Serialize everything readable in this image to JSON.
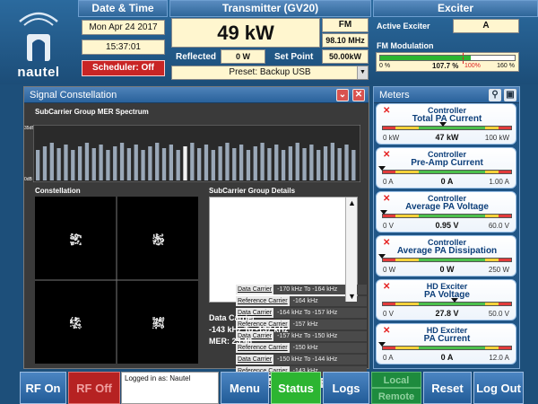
{
  "brand": {
    "logo_text": "nautel"
  },
  "date_time": {
    "header": "Date & Time",
    "date": "Mon Apr 24 2017",
    "time": "15:37:01",
    "scheduler_button": "Scheduler: Off"
  },
  "transmitter": {
    "header": "Transmitter (GV20)",
    "power": "49 kW",
    "mode": "FM",
    "frequency": "98.10 MHz",
    "reflected_label": "Reflected",
    "reflected_value": "0 W",
    "setpoint_label": "Set Point",
    "setpoint_value": "50.00kW",
    "preset": "Preset: Backup USB"
  },
  "exciter": {
    "header": "Exciter",
    "active_label": "Active Exciter",
    "active_value": "A",
    "fm_mod_label": "FM Modulation",
    "fm_mod_low": "0 %",
    "fm_mod_value": "107.7 %",
    "fm_mod_limit": "100%",
    "fm_mod_high": "160 %",
    "fm_mod_level": 0.673
  },
  "signal_panel": {
    "title": "Signal Constellation",
    "mer_title": "SubCarrier Group MER Spectrum",
    "mer_top": "35dB",
    "mer_bottom": "0dB",
    "constellation_title": "Constellation",
    "details_title": "SubCarrier Group Details",
    "details_rows": [
      {
        "type": "Data Carrier",
        "range": "-170 kHz  To  -164 kHz"
      },
      {
        "type": "Reference Carrier",
        "range": "-164 kHz"
      },
      {
        "type": "Data Carrier",
        "range": "-164 kHz  To  -157 kHz"
      },
      {
        "type": "Reference Carrier",
        "range": "-157 kHz"
      },
      {
        "type": "Data Carrier",
        "range": "-157 kHz  To  -150 kHz"
      },
      {
        "type": "Reference Carrier",
        "range": "-150 kHz"
      },
      {
        "type": "Data Carrier",
        "range": "-150 kHz  To  -144 kHz"
      },
      {
        "type": "Reference Carrier",
        "range": "-143 kHz"
      },
      {
        "type": "Data Carrier",
        "range": "-143 kHz  To  -137 kHz"
      }
    ],
    "selected_type": "Data Carrier",
    "selected_range": "-143 kHz To -137 kHz",
    "selected_mer": "MER: 23.48"
  },
  "meters": {
    "title": "Meters",
    "items": [
      {
        "group": "Controller",
        "name": "Total PA Current",
        "low": "0 kW",
        "value": "47 kW",
        "high": "100 kW",
        "level": 0.47
      },
      {
        "group": "Controller",
        "name": "Pre-Amp Current",
        "low": "0 A",
        "value": "0 A",
        "high": "1.00 A",
        "level": 0.0
      },
      {
        "group": "Controller",
        "name": "Average PA Voltage",
        "low": "0 V",
        "value": "0.95 V",
        "high": "60.0 V",
        "level": 0.016
      },
      {
        "group": "Controller",
        "name": "Average PA Dissipation",
        "low": "0 W",
        "value": "0 W",
        "high": "250 W",
        "level": 0.0
      },
      {
        "group": "HD Exciter",
        "name": "PA Voltage",
        "low": "0 V",
        "value": "27.8 V",
        "high": "50.0 V",
        "level": 0.556
      },
      {
        "group": "HD Exciter",
        "name": "PA Current",
        "low": "0 A",
        "value": "0 A",
        "high": "12.0 A",
        "level": 0.0
      }
    ]
  },
  "bottom": {
    "rf_on": "RF On",
    "rf_off": "RF Off",
    "logged_in": "Logged in as: Nautel",
    "menu": "Menu",
    "status": "Status",
    "logs": "Logs",
    "local": "Local",
    "remote": "Remote",
    "reset": "Reset",
    "logout": "Log Out"
  },
  "colors": {
    "background": "#1d4f7a",
    "accent_green": "#2cb531",
    "rf_off_red": "#b62222",
    "scheduler_red": "#c82525"
  }
}
